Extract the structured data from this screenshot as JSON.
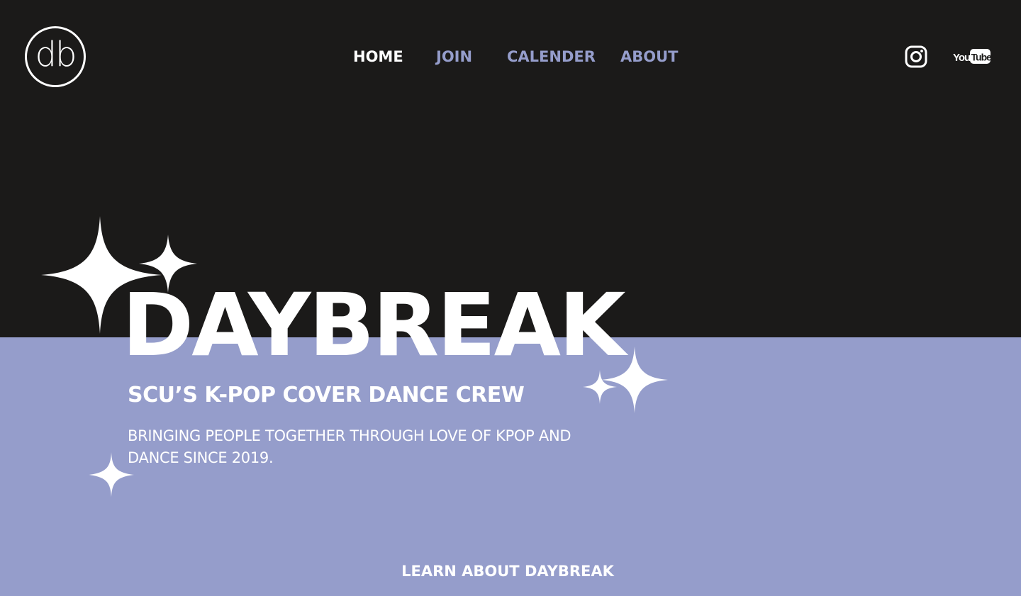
{
  "brand": {
    "logo_text": "db"
  },
  "nav": {
    "items": [
      {
        "label": "HOME"
      },
      {
        "label": "JOIN"
      },
      {
        "label": "CALENDER"
      },
      {
        "label": "ABOUT"
      }
    ],
    "active_index": 0
  },
  "social": {
    "instagram_icon": "instagram-icon",
    "youtube_icon": "youtube-icon",
    "youtube_text": {
      "you": "You",
      "tube": "Tube"
    }
  },
  "hero": {
    "title": "DAYBREAK",
    "subtitle": "SCU’S K-POP COVER DANCE CREW",
    "tagline": "BRINGING PEOPLE TOGETHER THROUGH LOVE OF KPOP AND DANCE SINCE 2019."
  },
  "cta": {
    "label": "LEARN ABOUT DAYBREAK"
  },
  "colors": {
    "dark_background": "#1b1a19",
    "lavender_background": "#959dcb",
    "accent_nav": "#959dcb",
    "text": "#ffffff"
  }
}
